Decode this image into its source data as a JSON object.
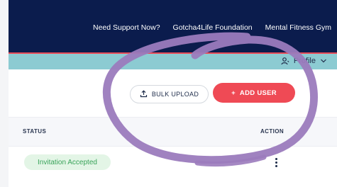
{
  "topbar": {
    "links": [
      "Need Support Now?",
      "Gotcha4Life Foundation",
      "Mental Fitness Gym"
    ]
  },
  "profile": {
    "label": "Profile",
    "icon": "user-icon",
    "chevron": "chevron-down-icon"
  },
  "actions": {
    "bulk_upload": "BULK UPLOAD",
    "add_user": "ADD USER",
    "add_user_prefix": "+"
  },
  "table": {
    "headers": {
      "status": "STATUS",
      "action": "ACTION"
    },
    "rows": [
      {
        "status": "Invitation Accepted"
      }
    ]
  },
  "colors": {
    "topbar": "#0b1c4d",
    "accent_line": "#e84b57",
    "subbar": "#8ccbd2",
    "add_button": "#ef4a55",
    "annotation_circle": "#9b7bbd",
    "status_badge_bg": "#e3f5e6",
    "status_badge_text": "#39a35a"
  }
}
